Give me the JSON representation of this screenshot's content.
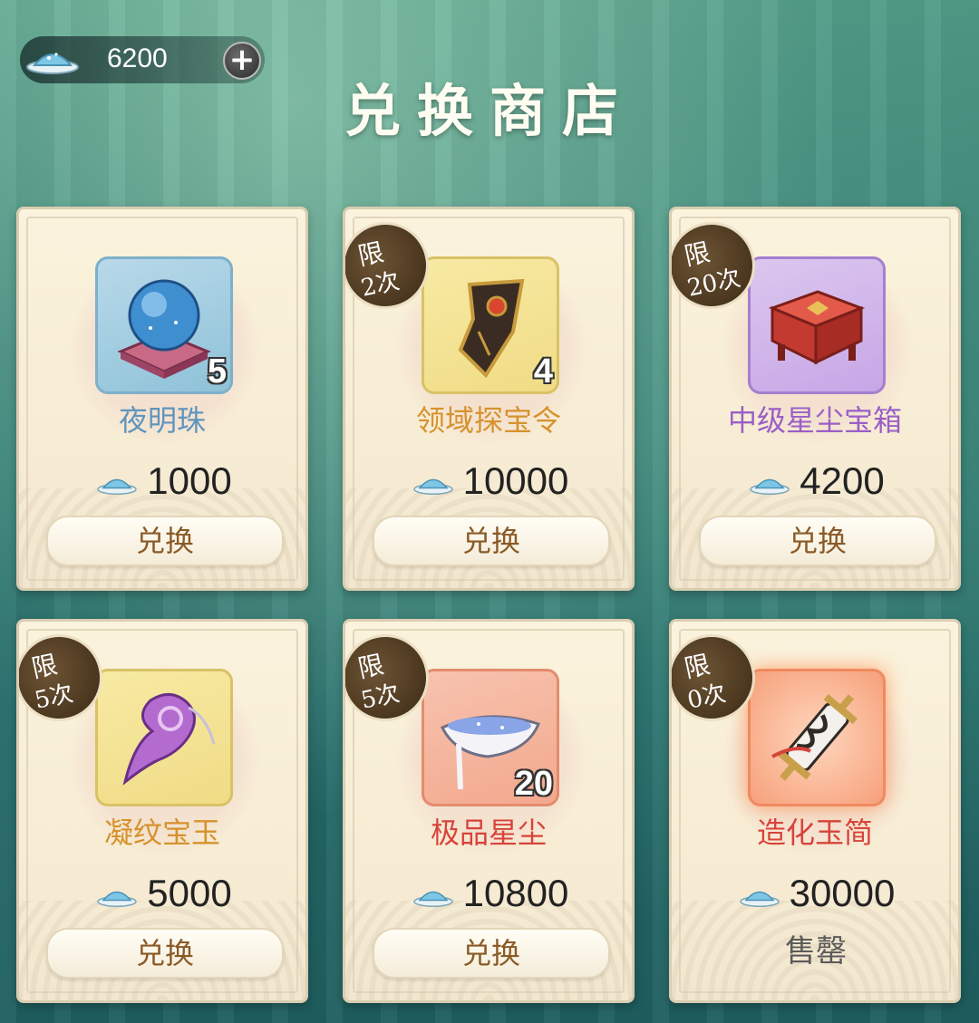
{
  "header": {
    "currency_amount": "6200",
    "add_label": "+",
    "title": "兑换商店"
  },
  "colors": {
    "name_blue": "#5f95bd",
    "name_gold": "#d6922c",
    "name_purple": "#9a5fc6",
    "name_red": "#d8433a"
  },
  "items": [
    {
      "name": "夜明珠",
      "count": "5",
      "price": "1000",
      "limit_line1": "",
      "limit_line2": "",
      "action": "兑换",
      "icon": "glowing-pearl-icon"
    },
    {
      "name": "领域探宝令",
      "count": "4",
      "price": "10000",
      "limit_line1": "限",
      "limit_line2": "2次",
      "action": "兑换",
      "icon": "treasure-token-icon"
    },
    {
      "name": "中级星尘宝箱",
      "count": "",
      "price": "4200",
      "limit_line1": "限",
      "limit_line2": "20次",
      "action": "兑换",
      "icon": "treasure-chest-icon"
    },
    {
      "name": "凝纹宝玉",
      "count": "",
      "price": "5000",
      "limit_line1": "限",
      "limit_line2": "5次",
      "action": "兑换",
      "icon": "jade-icon"
    },
    {
      "name": "极品星尘",
      "count": "20",
      "price": "10800",
      "limit_line1": "限",
      "limit_line2": "5次",
      "action": "兑换",
      "icon": "stardust-icon"
    },
    {
      "name": "造化玉简",
      "count": "",
      "price": "30000",
      "limit_line1": "限",
      "limit_line2": "0次",
      "action": "售罄",
      "icon": "jade-scroll-icon"
    }
  ]
}
